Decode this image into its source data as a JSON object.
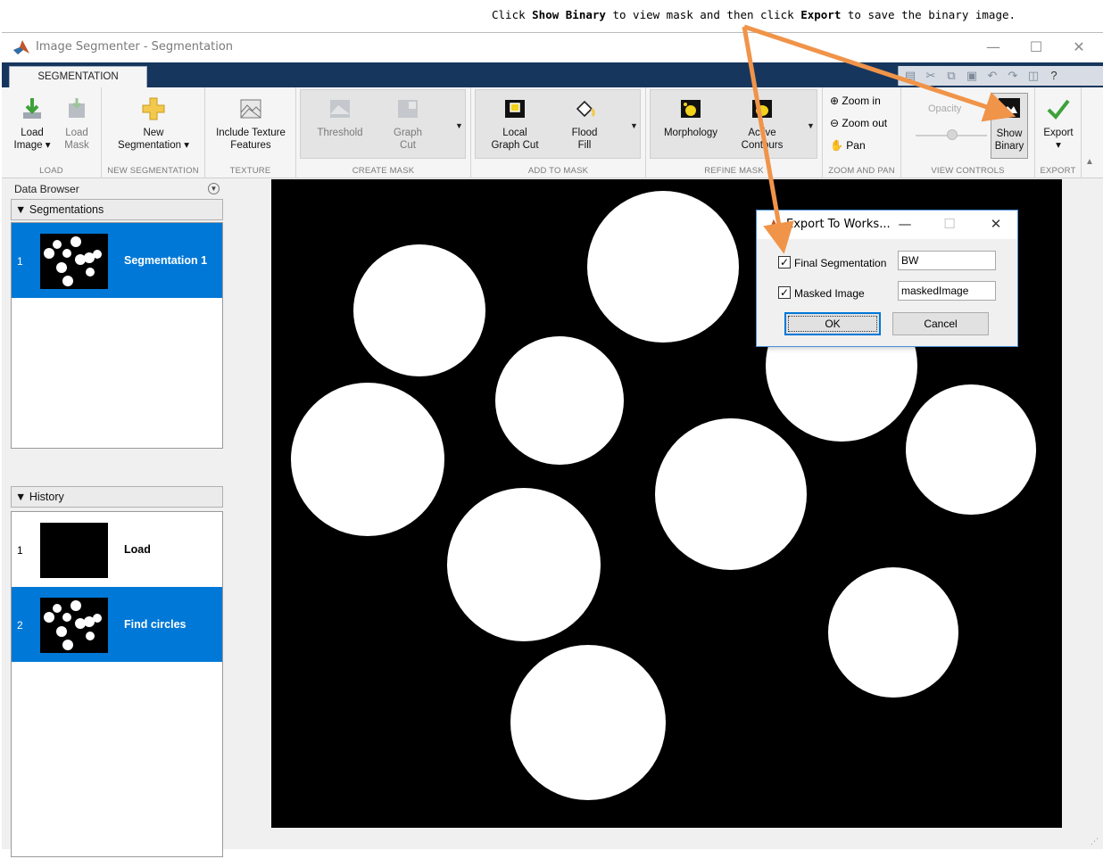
{
  "annotation": {
    "part1": "Click ",
    "bold1": "Show Binary",
    "part2": " to view mask and then click ",
    "bold2": "Export",
    "part3": " to save the binary image."
  },
  "window": {
    "title": "Image Segmenter - Segmentation",
    "controls": {
      "minimize": "—",
      "maximize": "☐",
      "close": "✕"
    }
  },
  "ribbon": {
    "tab": "SEGMENTATION",
    "quick_access_icons": [
      "save-icon",
      "cut-icon",
      "copy-icon",
      "paste-icon",
      "undo-icon",
      "redo-icon",
      "layout-icon",
      "help-icon"
    ],
    "sections": {
      "load": "LOAD",
      "new_segmentation": "NEW SEGMENTATION",
      "texture": "TEXTURE",
      "create_mask": "CREATE MASK",
      "add_to_mask": "ADD TO MASK",
      "refine_mask": "REFINE MASK",
      "zoom_and_pan": "ZOOM AND PAN",
      "view_controls": "VIEW CONTROLS",
      "export": "EXPORT"
    },
    "buttons": {
      "load_image_1": "Load",
      "load_image_2": "Image ▾",
      "load_mask_1": "Load",
      "load_mask_2": "Mask",
      "new_seg_1": "New",
      "new_seg_2": "Segmentation ▾",
      "texture_1": "Include Texture",
      "texture_2": "Features",
      "threshold": "Threshold",
      "graph_cut_1": "Graph",
      "graph_cut_2": "Cut",
      "local_graph_cut_1": "Local",
      "local_graph_cut_2": "Graph Cut",
      "flood_fill_1": "Flood",
      "flood_fill_2": "Fill",
      "morphology": "Morphology",
      "active_contours_1": "Active",
      "active_contours_2": "Contours",
      "zoom_in": "Zoom in",
      "zoom_out": "Zoom out",
      "pan": "Pan",
      "opacity": "Opacity",
      "show_binary_1": "Show",
      "show_binary_2": "Binary",
      "export_1": "Export",
      "export_2": "▾"
    }
  },
  "data_browser": {
    "title": "Data Browser",
    "segmentations_header": "Segmentations",
    "segmentations": [
      {
        "num": "1",
        "label": "Segmentation 1"
      }
    ],
    "history_header": "History",
    "history": [
      {
        "num": "1",
        "label": "Load"
      },
      {
        "num": "2",
        "label": "Find circles"
      }
    ]
  },
  "dialog": {
    "title": "Export To Works...",
    "controls": {
      "minimize": "—",
      "maximize": "☐",
      "close": "✕"
    },
    "row1_label": "Final Segmentation",
    "row1_value": "BW",
    "row2_label": "Masked Image",
    "row2_value": "maskedImage",
    "ok": "OK",
    "cancel": "Cancel"
  },
  "colors": {
    "arrow": "#f0944a",
    "selection": "#0078d7",
    "tab_strip": "#17365d"
  }
}
